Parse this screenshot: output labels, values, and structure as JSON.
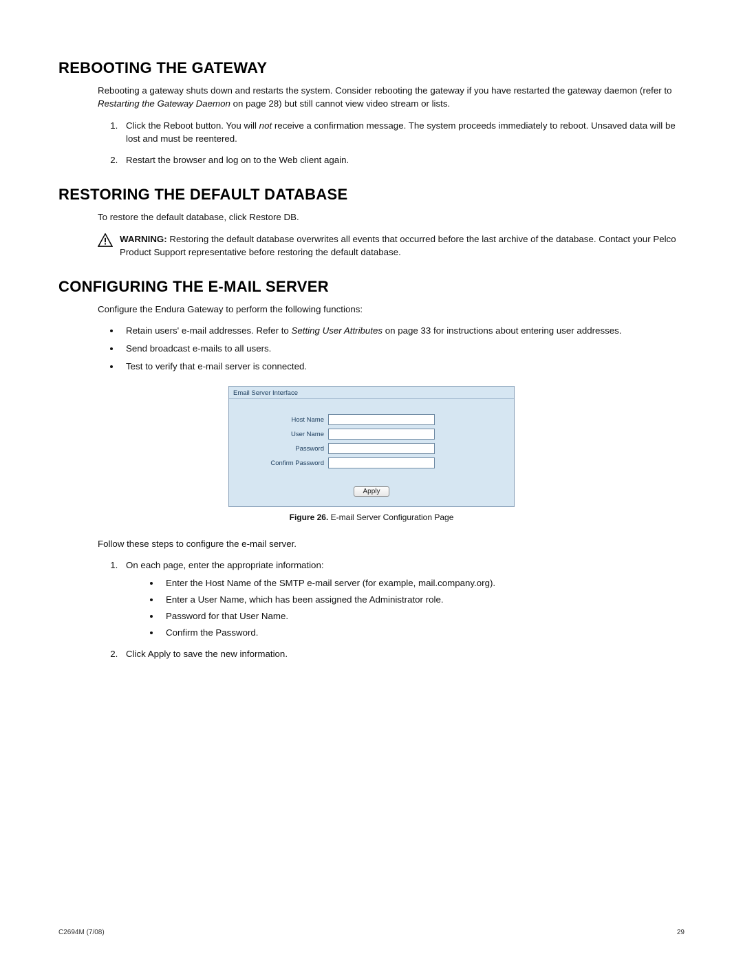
{
  "section1": {
    "heading": "REBOOTING THE GATEWAY",
    "intro_a": "Rebooting a gateway shuts down and restarts the system. Consider rebooting the gateway if you have restarted the gateway daemon (refer to ",
    "intro_ref": "Restarting the Gateway Daemon",
    "intro_b": " on page 28) but still cannot view video stream or lists.",
    "step1_a": "Click the Reboot button. You will ",
    "step1_not": "not",
    "step1_b": " receive a confirmation message. The system proceeds immediately to reboot. Unsaved data will be lost and must be reentered.",
    "step2": "Restart the browser and log on to the Web client again."
  },
  "section2": {
    "heading": "RESTORING THE DEFAULT DATABASE",
    "intro": "To restore the default database, click Restore DB.",
    "warn_label": "WARNING:",
    "warn_body": "  Restoring the default database overwrites all events that occurred before the last archive of the database. Contact your Pelco Product Support representative before restoring the default database."
  },
  "section3": {
    "heading": "CONFIGURING THE E-MAIL SERVER",
    "intro": "Configure the Endura Gateway to perform the following functions:",
    "b1_a": "Retain users' e-mail addresses. Refer to ",
    "b1_ref": "Setting User Attributes",
    "b1_b": " on page 33 for instructions about entering user addresses.",
    "b2": "Send broadcast e-mails to all users.",
    "b3": "Test to verify that e-mail server is connected."
  },
  "email_panel": {
    "title": "Email Server Interface",
    "host_label": "Host Name",
    "user_label": "User Name",
    "pass_label": "Password",
    "confirm_label": "Confirm Password",
    "apply_label": "Apply"
  },
  "figure": {
    "label": "Figure 26.",
    "caption": "  E-mail Server Configuration Page"
  },
  "section4": {
    "intro": "Follow these steps to configure the e-mail server.",
    "step1": "On each page, enter the appropriate information:",
    "s1b1": "Enter the Host Name of the SMTP e-mail server (for example, mail.company.org).",
    "s1b2": "Enter a User Name, which has been assigned the Administrator role.",
    "s1b3": "Password for that User Name.",
    "s1b4": "Confirm the Password.",
    "step2": "Click Apply to save the new information."
  },
  "footer": {
    "left": "C2694M (7/08)",
    "right": "29"
  }
}
